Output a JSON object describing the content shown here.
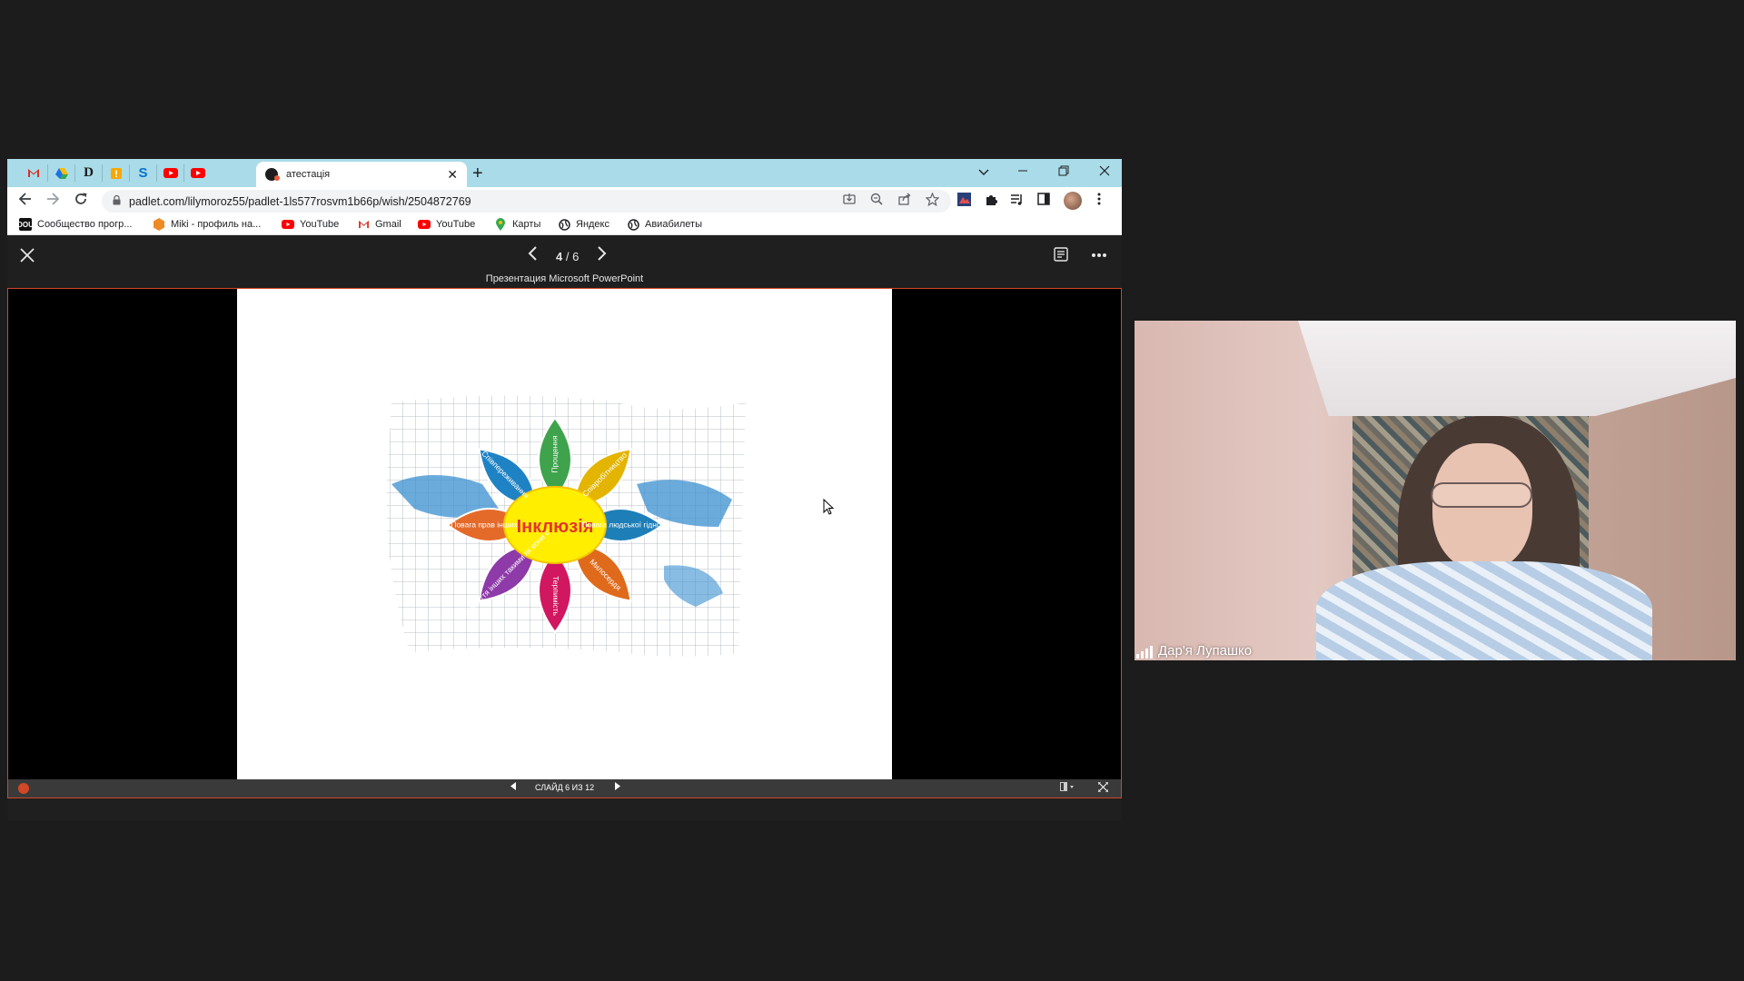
{
  "browser": {
    "active_tab_title": "атестація",
    "new_tab_icon": "+",
    "url": "padlet.com/lilymoroz55/padlet-1ls577rosvm1b66p/wish/2504872769",
    "bookmarks": [
      {
        "label": "Сообщество прогр...",
        "icon": "dou-icon"
      },
      {
        "label": "Miki - профиль на...",
        "icon": "miki-icon"
      },
      {
        "label": "YouTube",
        "icon": "youtube-icon"
      },
      {
        "label": "Gmail",
        "icon": "gmail-icon"
      },
      {
        "label": "YouTube",
        "icon": "youtube-icon"
      },
      {
        "label": "Карты",
        "icon": "maps-pin-icon"
      },
      {
        "label": "Яндекс",
        "icon": "globe-icon"
      },
      {
        "label": "Авиабилеты",
        "icon": "globe-icon"
      }
    ]
  },
  "viewer": {
    "page_current": "4",
    "page_total": "/ 6",
    "caption": "Презентация Microsoft PowerPoint",
    "ppt_counter": "СЛАЙД 6 ИЗ 12"
  },
  "slide": {
    "center_label": "Інклюзія",
    "petals": [
      {
        "label": "Прощення",
        "color": "#3fa34d"
      },
      {
        "label": "Співробітництво",
        "color": "#e3b400"
      },
      {
        "label": "Повага людської гідності",
        "color": "#1e7fb8"
      },
      {
        "label": "Милосердя",
        "color": "#e06a1b"
      },
      {
        "label": "Терпимість",
        "color": "#d11760"
      },
      {
        "label": "Прийняття інших такими як вони є",
        "color": "#8e3aa8"
      },
      {
        "label": "Повага прав інших",
        "color": "#e46a2a"
      },
      {
        "label": "Співпереживання",
        "color": "#1f82c4"
      }
    ]
  },
  "webcam": {
    "participant_name": "Дар'я Лупашко"
  },
  "colors": {
    "tabstrip": "#a9dbe8",
    "powerpoint_accent": "#d24726",
    "center_yellow": "#ffee00",
    "center_text": "#e3342f"
  }
}
